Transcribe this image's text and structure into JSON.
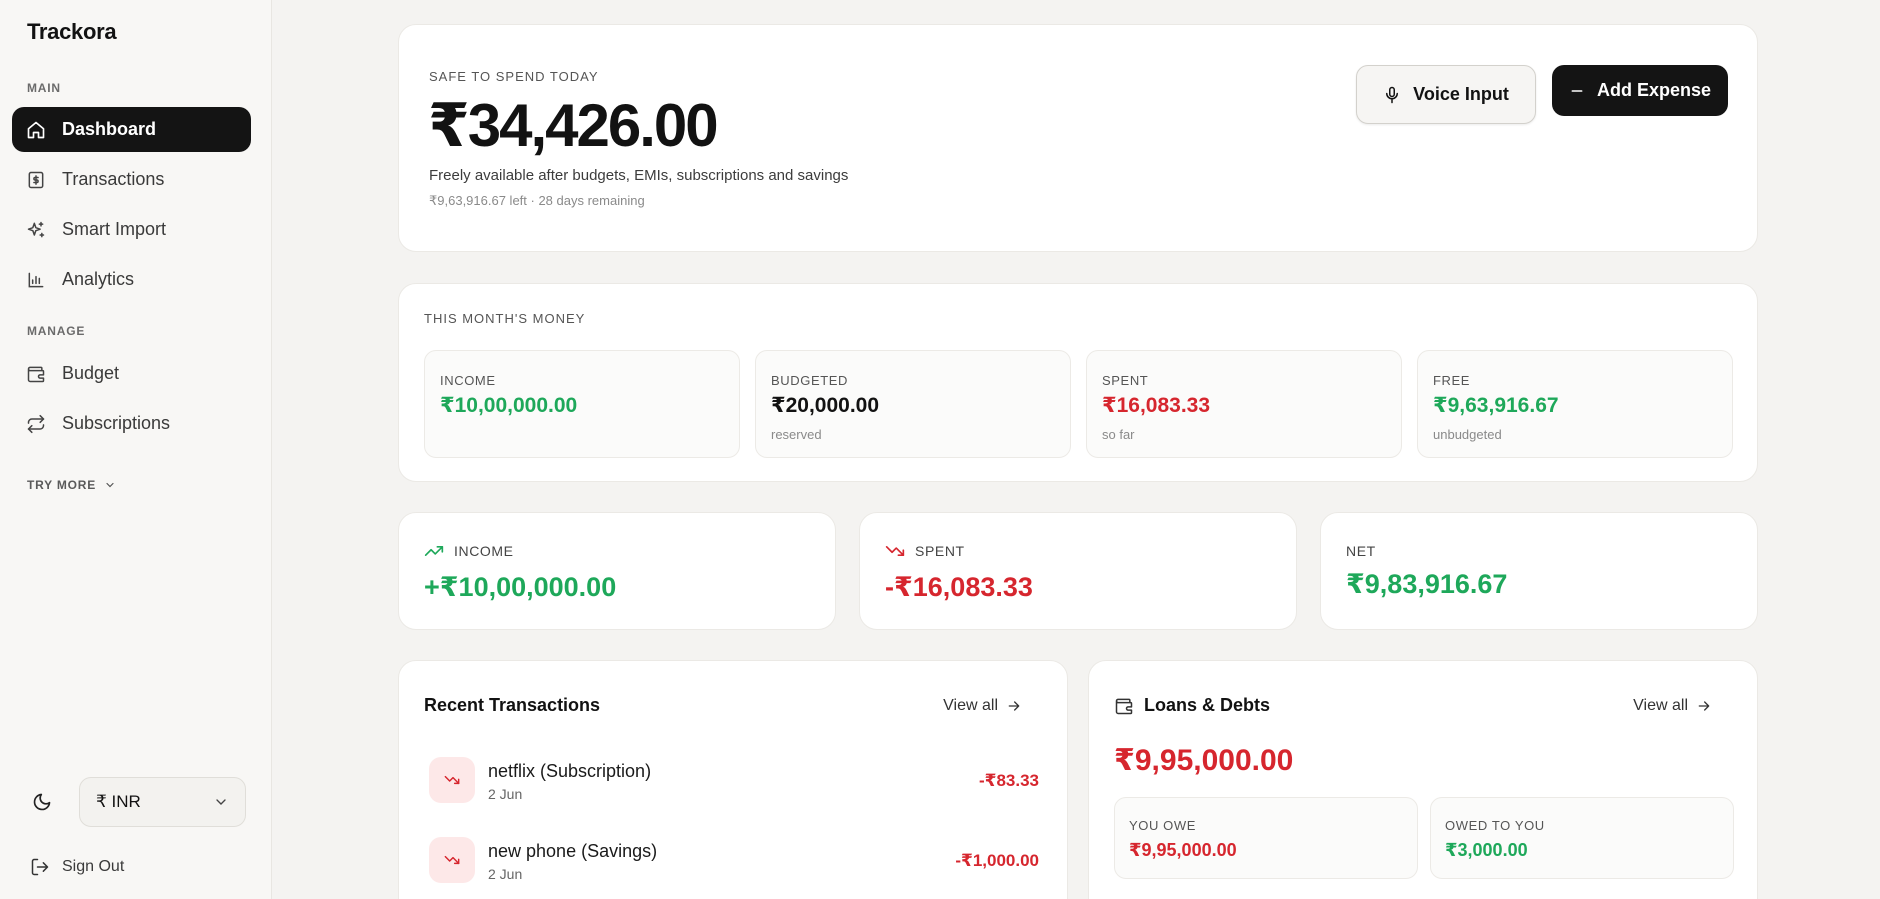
{
  "app": {
    "name": "Trackora"
  },
  "sidebar": {
    "section_main": "MAIN",
    "section_manage": "MANAGE",
    "main_items": [
      {
        "label": "Dashboard",
        "icon": "home-icon",
        "active": true
      },
      {
        "label": "Transactions",
        "icon": "receipt-icon"
      },
      {
        "label": "Smart Import",
        "icon": "sparkles-icon"
      },
      {
        "label": "Analytics",
        "icon": "bar-chart-icon"
      }
    ],
    "manage_items": [
      {
        "label": "Budget",
        "icon": "wallet-icon"
      },
      {
        "label": "Subscriptions",
        "icon": "repeat-icon"
      }
    ],
    "try_more": "TRY MORE",
    "currency": "₹ INR",
    "sign_out": "Sign Out"
  },
  "hero": {
    "eyebrow": "SAFE TO SPEND TODAY",
    "amount": "₹34,426.00",
    "description": "Freely available after budgets, EMIs, subscriptions and savings",
    "sub": "₹9,63,916.67 left · 28 days remaining",
    "voice_button": "Voice Input",
    "add_button": "Add Expense"
  },
  "month": {
    "title": "THIS MONTH'S MONEY",
    "stats": [
      {
        "label": "INCOME",
        "value": "₹10,00,000.00",
        "note": "",
        "color": "#1ea85a"
      },
      {
        "label": "BUDGETED",
        "value": "₹20,000.00",
        "note": "reserved",
        "color": "#121212"
      },
      {
        "label": "SPENT",
        "value": "₹16,083.33",
        "note": "so far",
        "color": "#d6262e"
      },
      {
        "label": "FREE",
        "value": "₹9,63,916.67",
        "note": "unbudgeted",
        "color": "#1ea85a"
      }
    ]
  },
  "summary": {
    "income_label": "INCOME",
    "income_value": "+₹10,00,000.00",
    "spent_label": "SPENT",
    "spent_value": "-₹16,083.33",
    "net_label": "NET",
    "net_value": "₹9,83,916.67"
  },
  "recent": {
    "title": "Recent Transactions",
    "view_all": "View all",
    "items": [
      {
        "name": "netflix (Subscription)",
        "date": "2 Jun",
        "amount": "-₹83.33"
      },
      {
        "name": "new phone (Savings)",
        "date": "2 Jun",
        "amount": "-₹1,000.00"
      }
    ]
  },
  "loans": {
    "title": "Loans & Debts",
    "view_all": "View all",
    "total": "₹9,95,000.00",
    "you_owe_label": "YOU OWE",
    "you_owe_value": "₹9,95,000.00",
    "owed_label": "OWED TO YOU",
    "owed_value": "₹3,000.00"
  },
  "colors": {
    "positive": "#1ea85a",
    "negative": "#d6262e",
    "dark": "#141414"
  }
}
